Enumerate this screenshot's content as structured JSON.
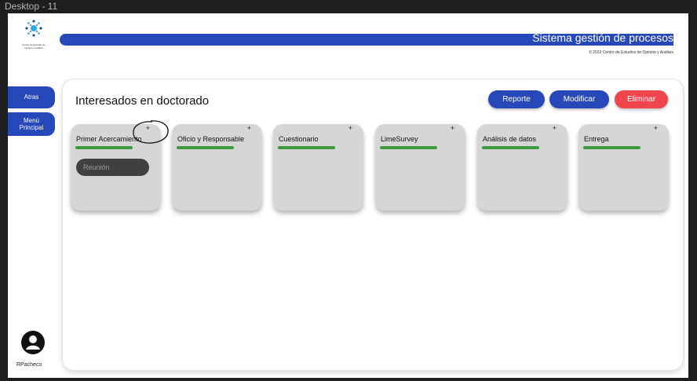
{
  "frame_label": "Desktop - 11",
  "logo": {
    "text_line1": "Centro de Estudios de",
    "text_line2": "Opinión y Análisis"
  },
  "header": {
    "title": "Sistema gestión de procesos",
    "subtitle": "© 2023 Centro de Estudios de Opinión y Análisis",
    "brand_color": "#2748b8"
  },
  "sidebar": {
    "atras_label": "Atras",
    "menu_line1": "Menú",
    "menu_line2": "Principal"
  },
  "user": {
    "name": "RPacheco",
    "icon": "user-avatar-icon"
  },
  "panel": {
    "title": "Interesados en doctorado",
    "buttons": {
      "reporte": "Reporte",
      "modificar": "Modificar",
      "eliminar": "Eliminar"
    },
    "danger_color": "#f0454d"
  },
  "stages": [
    {
      "label": "Primer Acercamiento",
      "plus": "+",
      "tasks": [
        "Reunión"
      ]
    },
    {
      "label": "Oficio y Responsable",
      "plus": "+"
    },
    {
      "label": "Cuestionario",
      "plus": "+"
    },
    {
      "label": "LimeSurvey",
      "plus": "+"
    },
    {
      "label": "Análisis de datos",
      "plus": "+"
    },
    {
      "label": "Entrega",
      "plus": "+"
    }
  ],
  "progress_color": "#3c9a3c"
}
